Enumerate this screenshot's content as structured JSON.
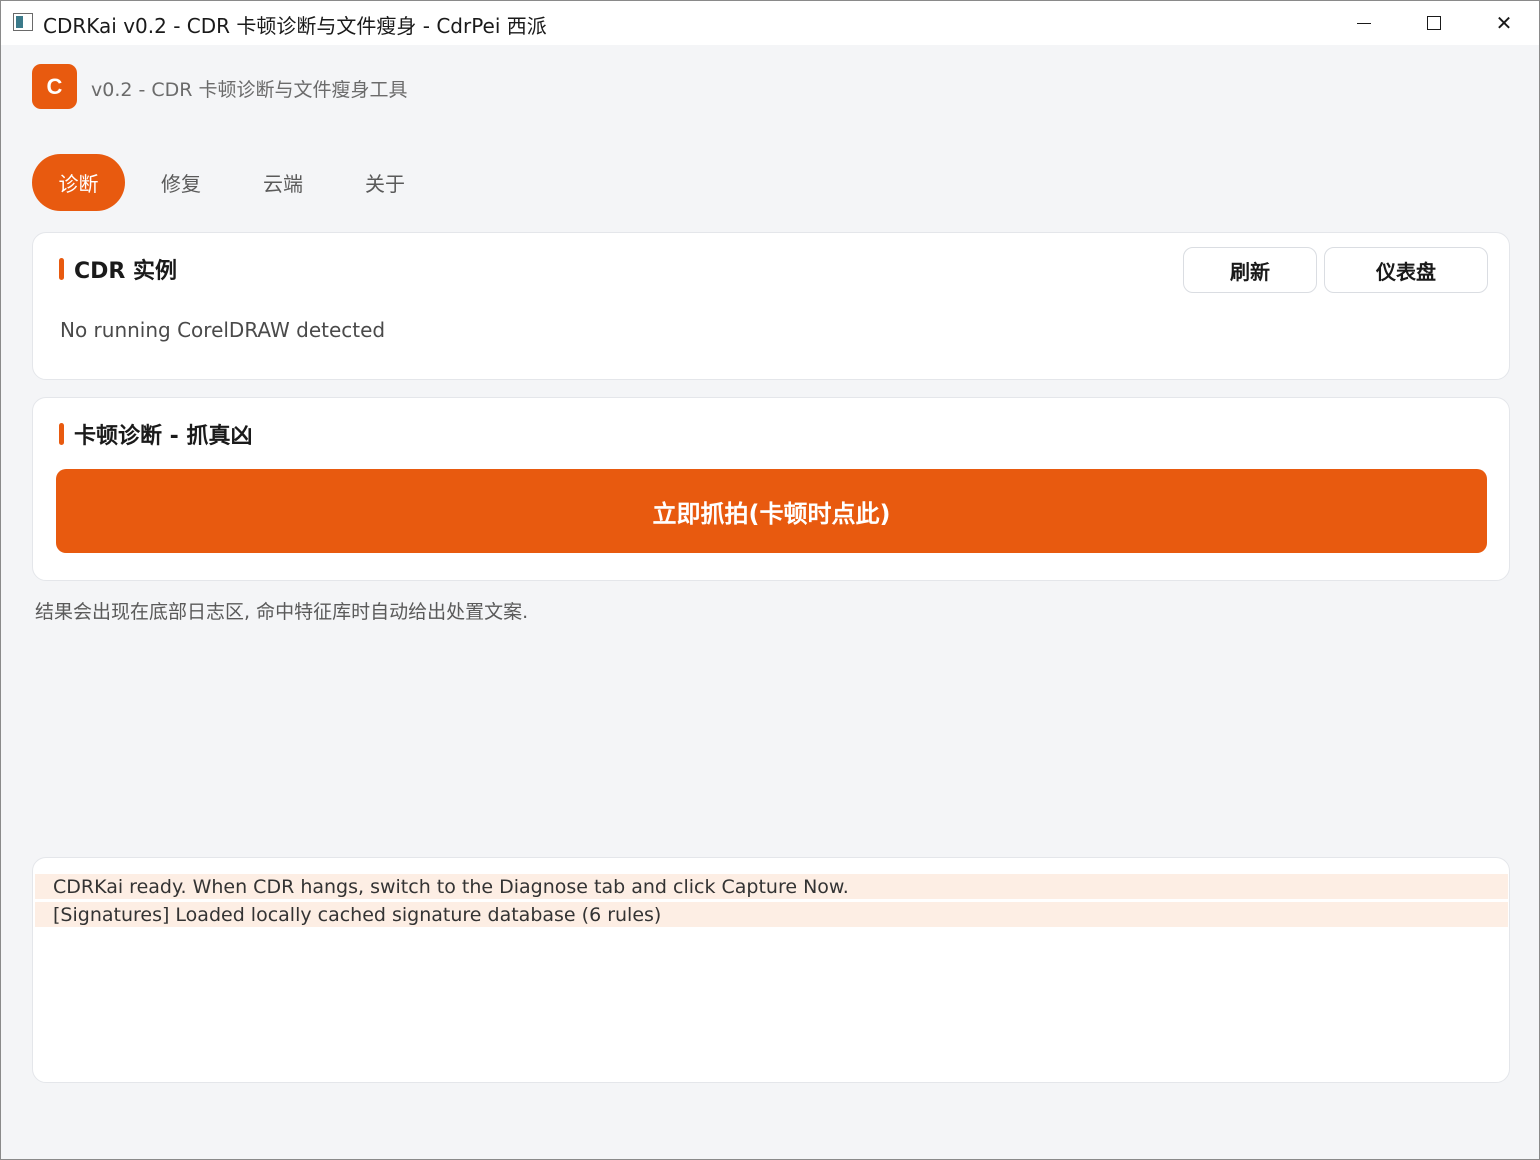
{
  "window": {
    "title": "CDRKai v0.2 - CDR 卡顿诊断与文件瘦身 - CdrPei 西派",
    "icon": "app-window-icon",
    "controls": {
      "minimize": "minimize-icon",
      "maximize": "maximize-icon",
      "close": "close-icon",
      "close_glyph": "✕"
    }
  },
  "header": {
    "logo_letter": "C",
    "subtitle": "v0.2 - CDR 卡顿诊断与文件瘦身工具"
  },
  "tabs": [
    {
      "label": "诊断",
      "active": true
    },
    {
      "label": "修复",
      "active": false
    },
    {
      "label": "云端",
      "active": false
    },
    {
      "label": "关于",
      "active": false
    }
  ],
  "instances": {
    "title": "CDR 实例",
    "refresh_label": "刷新",
    "dashboard_label": "仪表盘",
    "status": "No running CorelDRAW detected"
  },
  "diagnose": {
    "title": "卡顿诊断 - 抓真凶",
    "capture_label": "立即抓拍(卡顿时点此)"
  },
  "hint": "结果会出现在底部日志区, 命中特征库时自动给出处置文案.",
  "log": {
    "lines": [
      "CDRKai ready. When CDR hangs, switch to the Diagnose tab and click Capture Now.",
      "[Signatures] Loaded locally cached signature database (6 rules)"
    ]
  },
  "colors": {
    "accent": "#e85a0f",
    "log_highlight": "#fdeee4",
    "background": "#f4f5f7"
  }
}
